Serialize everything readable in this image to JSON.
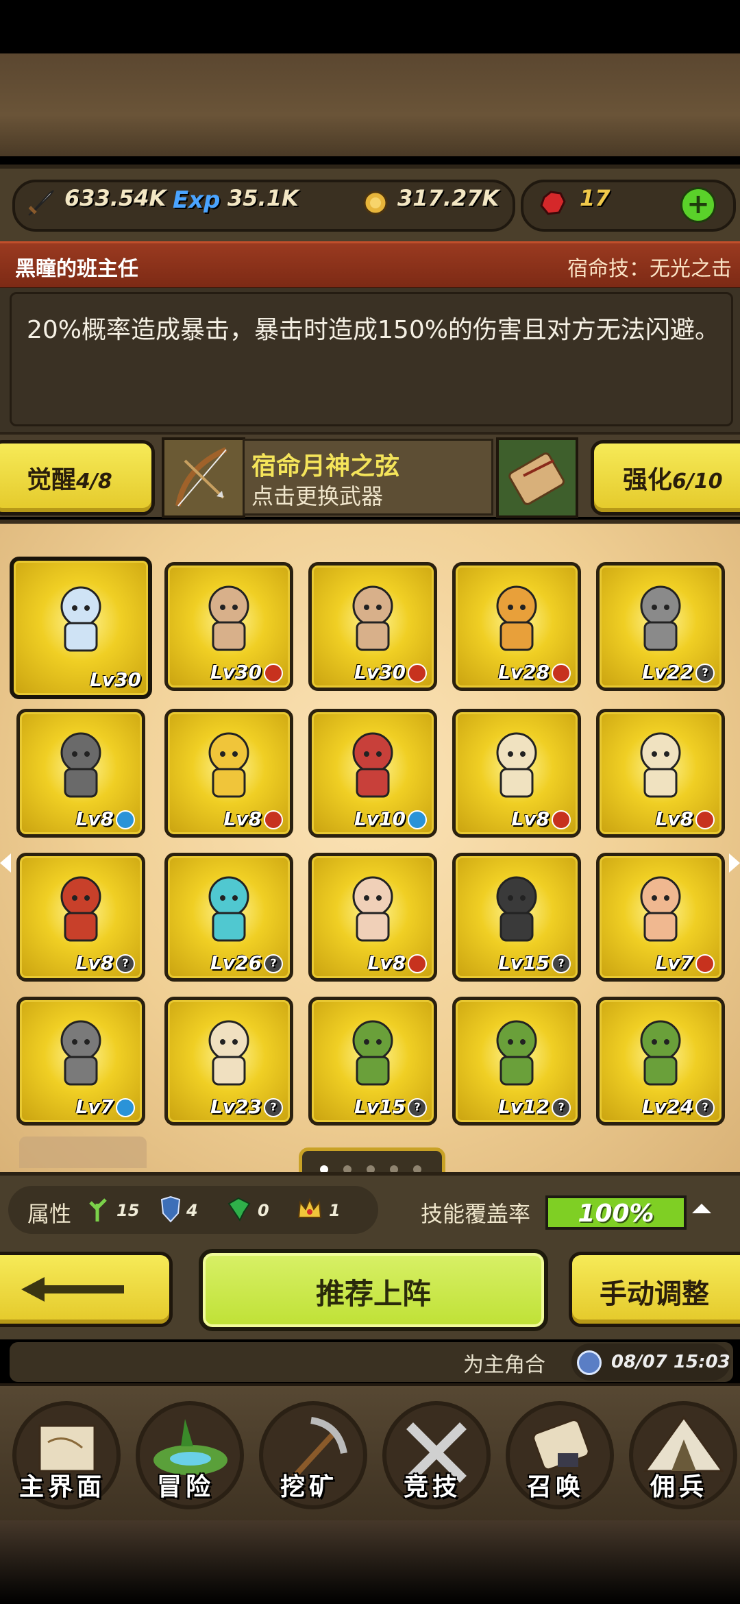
{
  "resources": {
    "attack": "633.54K",
    "exp_label": "Exp",
    "exp": "35.1K",
    "gold": "317.27K",
    "gems": "17",
    "plus": "+"
  },
  "skill": {
    "hero_name": "黑瞳的班主任",
    "fate_skill": "宿命技：无光之击",
    "description": "20%概率造成暴击，暴击时造成150%的伤害且对方无法闪避。"
  },
  "weapon": {
    "awaken_label": "觉醒",
    "awaken_value": "4/8",
    "name": "宿命月神之弦",
    "change_hint": "点击更换武器",
    "enhance_label": "强化",
    "enhance_value": "6/10"
  },
  "heroes": [
    {
      "lv": "Lv30",
      "badge": ""
    },
    {
      "lv": "Lv30",
      "badge": "red"
    },
    {
      "lv": "Lv30",
      "badge": "red"
    },
    {
      "lv": "Lv28",
      "badge": "red"
    },
    {
      "lv": "Lv22",
      "badge": "grey"
    },
    {
      "lv": "Lv8",
      "badge": "blue"
    },
    {
      "lv": "Lv8",
      "badge": "red"
    },
    {
      "lv": "Lv10",
      "badge": "blue"
    },
    {
      "lv": "Lv8",
      "badge": "red"
    },
    {
      "lv": "Lv8",
      "badge": "red"
    },
    {
      "lv": "Lv8",
      "badge": "grey"
    },
    {
      "lv": "Lv26",
      "badge": "grey"
    },
    {
      "lv": "Lv8",
      "badge": "red"
    },
    {
      "lv": "Lv15",
      "badge": "grey"
    },
    {
      "lv": "Lv7",
      "badge": "red"
    },
    {
      "lv": "Lv7",
      "badge": "blue"
    },
    {
      "lv": "Lv23",
      "badge": "grey"
    },
    {
      "lv": "Lv15",
      "badge": "grey"
    },
    {
      "lv": "Lv12",
      "badge": "grey"
    },
    {
      "lv": "Lv24",
      "badge": "grey"
    }
  ],
  "pager": {
    "total": 5,
    "active": 0
  },
  "attributes": {
    "label": "属性",
    "nature": "15",
    "shield": "4",
    "gem": "0",
    "crown": "1",
    "coverage_label": "技能覆盖率",
    "coverage_value": "100%",
    "coverage_fraction": 1.0
  },
  "actions": {
    "recommend": "推荐上阵",
    "manual": "手动调整"
  },
  "status": {
    "text": "为主角合",
    "time": "08/07 15:03"
  },
  "nav": [
    {
      "label": "主界面",
      "icon": "map-scroll-icon"
    },
    {
      "label": "冒险",
      "icon": "island-icon"
    },
    {
      "label": "挖矿",
      "icon": "pickaxe-icon"
    },
    {
      "label": "竞技",
      "icon": "crossed-swords-icon"
    },
    {
      "label": "召唤",
      "icon": "summon-scroll-icon"
    },
    {
      "label": "佣兵",
      "icon": "tent-icon"
    }
  ],
  "colors": {
    "gold_card": "#f0cf24",
    "green_button": "#c9e647",
    "skill_header": "#8a3219",
    "badge_red": "#c7321e",
    "badge_blue": "#2a93d8"
  }
}
